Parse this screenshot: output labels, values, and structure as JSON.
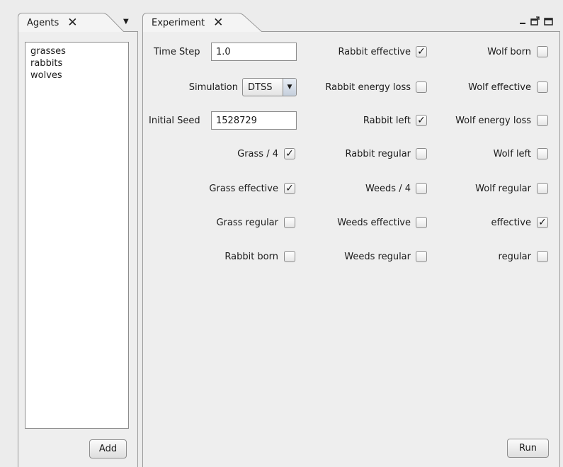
{
  "tabs": {
    "agents": {
      "label": "Agents",
      "close": "✕",
      "menu": "▼"
    },
    "experiment": {
      "label": "Experiment",
      "close": "✕"
    }
  },
  "window_controls": [
    "minimize",
    "float",
    "maximize"
  ],
  "agents": {
    "items": [
      {
        "label": "grasses"
      },
      {
        "label": "rabbits"
      },
      {
        "label": "wolves"
      }
    ],
    "add_label": "Add"
  },
  "experiment": {
    "time_step": {
      "label": "Time Step",
      "value": "1.0"
    },
    "simulation": {
      "label": "Simulation",
      "value": "DTSS",
      "arrow": "▼"
    },
    "initial_seed": {
      "label": "Initial Seed",
      "value": "1528729"
    },
    "col1": [
      {
        "label": "Grass / 4",
        "checked": true
      },
      {
        "label": "Grass effective",
        "checked": true
      },
      {
        "label": "Grass regular",
        "checked": false
      },
      {
        "label": "Rabbit born",
        "checked": false
      }
    ],
    "col2": [
      {
        "label": "Rabbit effective",
        "checked": true
      },
      {
        "label": "Rabbit energy loss",
        "checked": false
      },
      {
        "label": "Rabbit left",
        "checked": true
      },
      {
        "label": "Rabbit regular",
        "checked": false
      },
      {
        "label": "Weeds / 4",
        "checked": false
      },
      {
        "label": "Weeds effective",
        "checked": false
      },
      {
        "label": "Weeds regular",
        "checked": false
      }
    ],
    "col3": [
      {
        "label": "Wolf born",
        "checked": false
      },
      {
        "label": "Wolf effective",
        "checked": false
      },
      {
        "label": "Wolf energy loss",
        "checked": false
      },
      {
        "label": "Wolf left",
        "checked": false
      },
      {
        "label": "Wolf regular",
        "checked": false
      },
      {
        "label": "effective",
        "checked": true
      },
      {
        "label": "regular",
        "checked": false
      }
    ],
    "run_label": "Run"
  }
}
